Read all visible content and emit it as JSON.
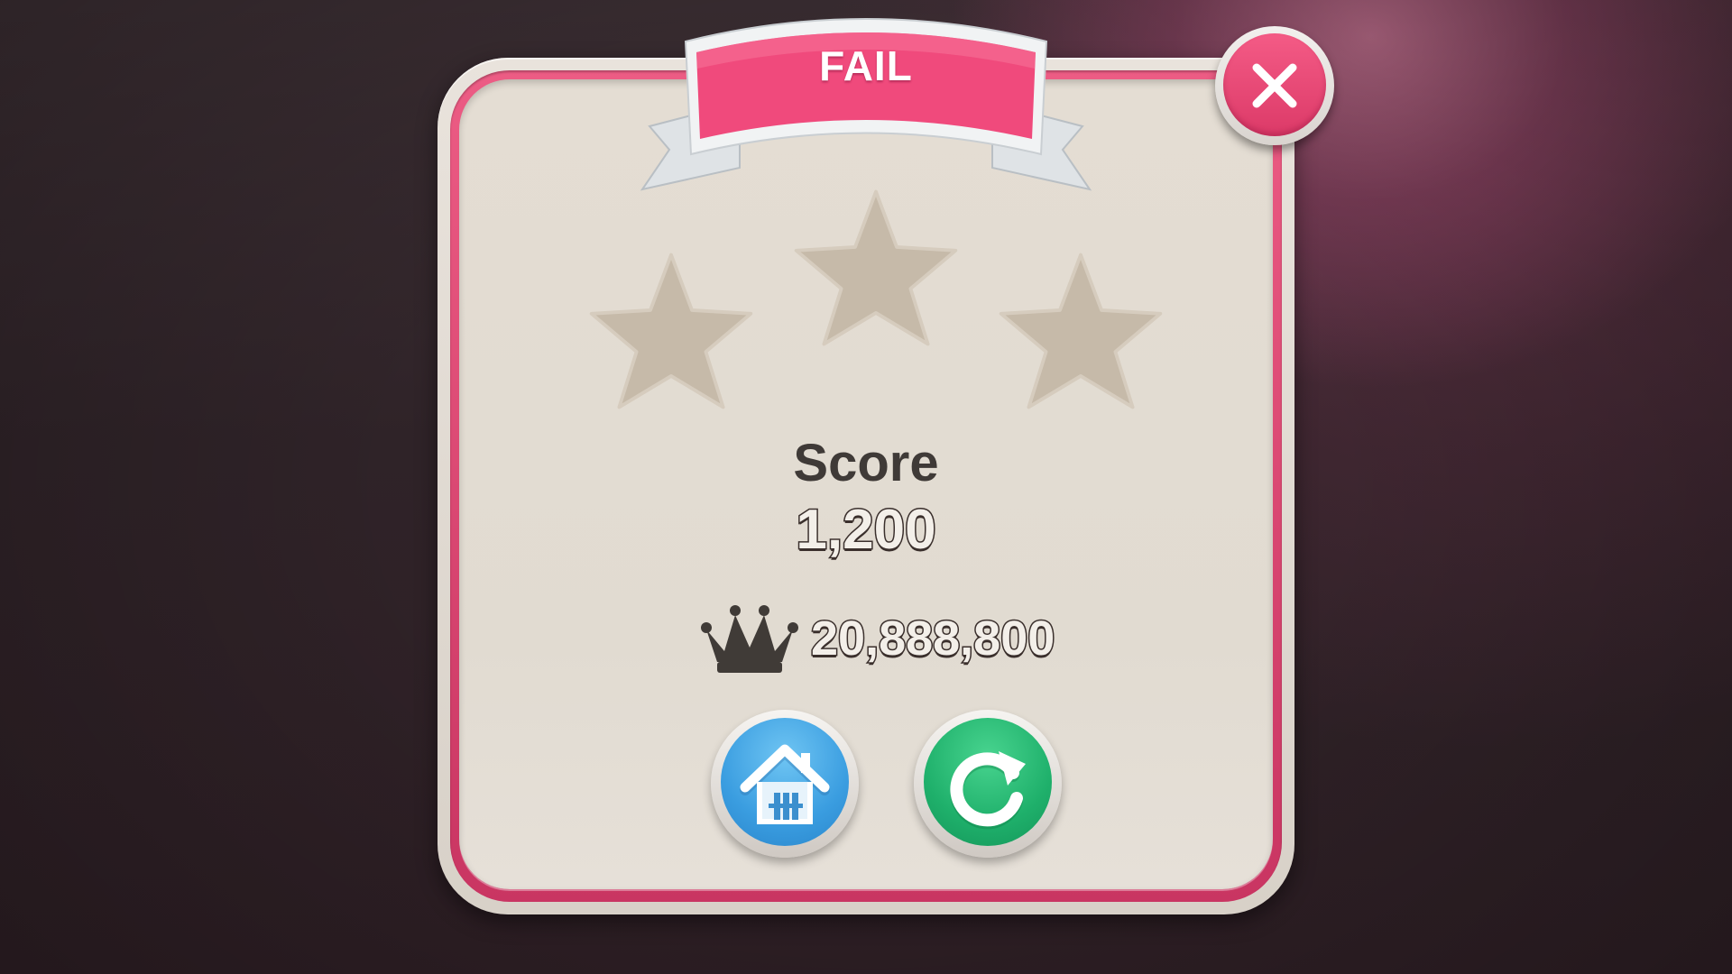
{
  "dialog": {
    "title": "FAIL",
    "score_label": "Score",
    "score_value": "1,200",
    "best_score": "20,888,800",
    "stars_earned": 0,
    "stars_total": 3
  },
  "buttons": {
    "close": "close-icon",
    "home": "home-icon",
    "replay": "replay-icon"
  },
  "colors": {
    "accent_pink": "#ec4f7e",
    "panel_cream": "#e3dcd2",
    "star_empty": "#c6baa9",
    "home_blue": "#3a9de0",
    "replay_green": "#1fb06b",
    "text_dark": "#3f3a37"
  }
}
